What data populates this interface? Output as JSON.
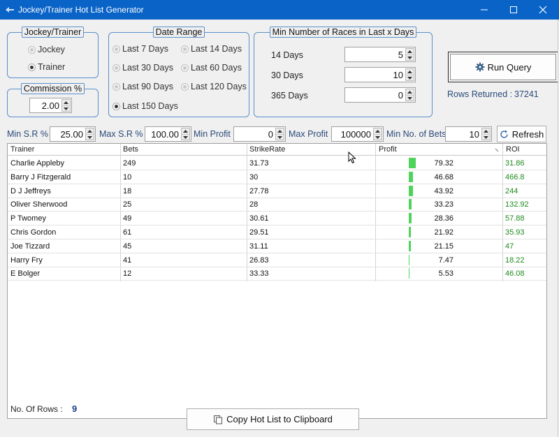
{
  "window": {
    "title": "Jockey/Trainer Hot List Generator",
    "icon": "app-icon",
    "controls": [
      "minimize-icon",
      "maximize-icon",
      "close-icon"
    ]
  },
  "jockey_trainer": {
    "legend": "Jockey/Trainer",
    "options": [
      {
        "label": "Jockey",
        "selected": false
      },
      {
        "label": "Trainer",
        "selected": true
      }
    ]
  },
  "commission": {
    "legend": "Commission %",
    "value": "2.00"
  },
  "date_range": {
    "legend": "Date Range",
    "options": [
      {
        "label": "Last 7 Days",
        "selected": false
      },
      {
        "label": "Last 14 Days",
        "selected": false
      },
      {
        "label": "Last 30 Days",
        "selected": false
      },
      {
        "label": "Last 60 Days",
        "selected": false
      },
      {
        "label": "Last 90 Days",
        "selected": false
      },
      {
        "label": "Last 120 Days",
        "selected": false
      },
      {
        "label": "Last 150 Days",
        "selected": true
      }
    ]
  },
  "min_races": {
    "legend": "Min Number of Races in Last x Days",
    "rows": [
      {
        "label": "14 Days",
        "value": "5"
      },
      {
        "label": "30 Days",
        "value": "10"
      },
      {
        "label": "365 Days",
        "value": "0"
      }
    ]
  },
  "run_query": {
    "label": "Run Query",
    "icon": "gear-icon"
  },
  "rows_returned": {
    "label": "Rows Returned :",
    "value": "37241"
  },
  "filters": {
    "min_sr_label": "Min S.R % :",
    "min_sr": "25.00",
    "max_sr_label": "Max S.R % :",
    "max_sr": "100.00",
    "min_profit_label": "Min Profit :",
    "min_profit": "0",
    "max_profit_label": "Max Profit :",
    "max_profit": "100000",
    "min_bets_label": "Min No. of Bets :",
    "min_bets": "10",
    "refresh_label": "Refresh",
    "refresh_icon": "refresh-icon"
  },
  "grid": {
    "columns": [
      "Trainer",
      "Bets",
      "StrikeRate",
      "Profit",
      "ROI"
    ],
    "profit_bar_color": "#4fd35a",
    "roi_color": "#1e8a1e",
    "rows": [
      {
        "trainer": "Charlie Appleby",
        "bets": "249",
        "strike_rate": "31.73",
        "profit": "79.32",
        "roi": "31.86",
        "bar_fraction": 1.0
      },
      {
        "trainer": "Barry J Fitzgerald",
        "bets": "10",
        "strike_rate": "30",
        "profit": "46.68",
        "roi": "466.8",
        "bar_fraction": 0.59
      },
      {
        "trainer": "D J Jeffreys",
        "bets": "18",
        "strike_rate": "27.78",
        "profit": "43.92",
        "roi": "244",
        "bar_fraction": 0.55
      },
      {
        "trainer": "Oliver Sherwood",
        "bets": "25",
        "strike_rate": "28",
        "profit": "33.23",
        "roi": "132.92",
        "bar_fraction": 0.42
      },
      {
        "trainer": "P Twomey",
        "bets": "49",
        "strike_rate": "30.61",
        "profit": "28.36",
        "roi": "57.88",
        "bar_fraction": 0.36
      },
      {
        "trainer": "Chris Gordon",
        "bets": "61",
        "strike_rate": "29.51",
        "profit": "21.92",
        "roi": "35.93",
        "bar_fraction": 0.28
      },
      {
        "trainer": "Joe Tizzard",
        "bets": "45",
        "strike_rate": "31.11",
        "profit": "21.15",
        "roi": "47",
        "bar_fraction": 0.27
      },
      {
        "trainer": "Harry Fry",
        "bets": "41",
        "strike_rate": "26.83",
        "profit": "7.47",
        "roi": "18.22",
        "bar_fraction": 0.09
      },
      {
        "trainer": "E Bolger",
        "bets": "12",
        "strike_rate": "33.33",
        "profit": "5.53",
        "roi": "46.08",
        "bar_fraction": 0.07
      }
    ],
    "row_count_label": "No. Of Rows :",
    "row_count": "9"
  },
  "copy_button": {
    "label": "Copy Hot List to Clipboard",
    "icon": "copy-icon"
  }
}
